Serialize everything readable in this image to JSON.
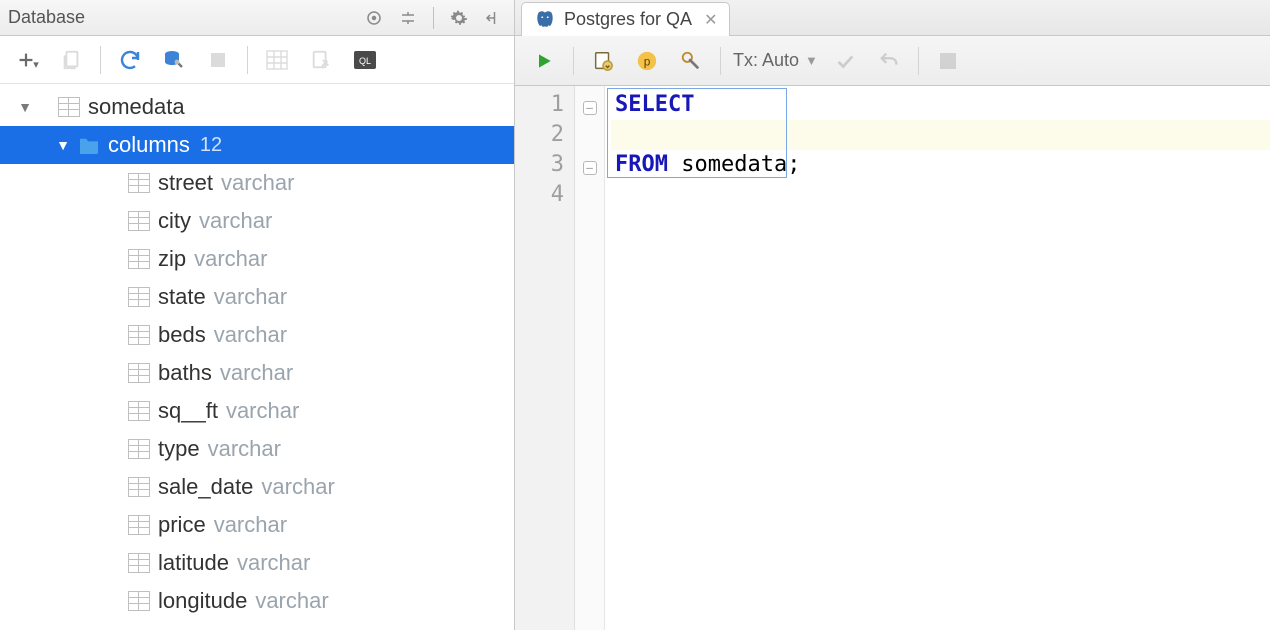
{
  "panel": {
    "title": "Database"
  },
  "tree": {
    "root": {
      "label": "somedata"
    },
    "group": {
      "label": "columns",
      "count": "12"
    },
    "columns": [
      {
        "name": "street",
        "type": "varchar"
      },
      {
        "name": "city",
        "type": "varchar"
      },
      {
        "name": "zip",
        "type": "varchar"
      },
      {
        "name": "state",
        "type": "varchar"
      },
      {
        "name": "beds",
        "type": "varchar"
      },
      {
        "name": "baths",
        "type": "varchar"
      },
      {
        "name": "sq__ft",
        "type": "varchar"
      },
      {
        "name": "type",
        "type": "varchar"
      },
      {
        "name": "sale_date",
        "type": "varchar"
      },
      {
        "name": "price",
        "type": "varchar"
      },
      {
        "name": "latitude",
        "type": "varchar"
      },
      {
        "name": "longitude",
        "type": "varchar"
      }
    ]
  },
  "tab": {
    "label": "Postgres for QA"
  },
  "toolbar": {
    "tx_label": "Tx: Auto"
  },
  "editor": {
    "line_numbers": [
      "1",
      "2",
      "3",
      "4"
    ],
    "l1_kw": "SELECT",
    "l3_kw": "FROM",
    "l3_rest": " somedata;"
  }
}
